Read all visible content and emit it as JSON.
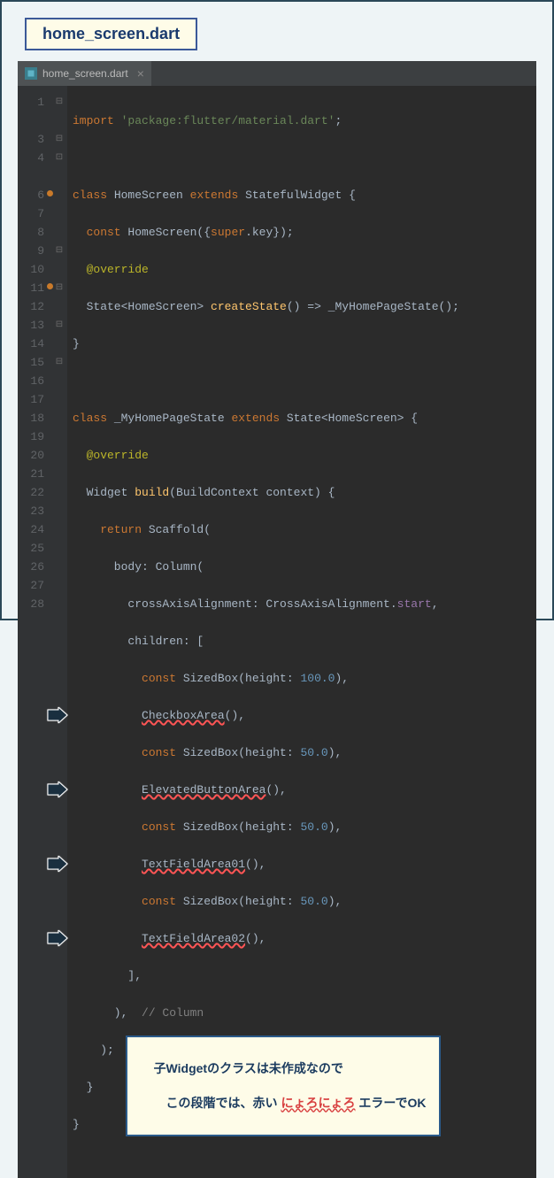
{
  "title_badge": "home_screen.dart",
  "tab": {
    "name": "home_screen.dart",
    "close": "×"
  },
  "gutter": {
    "lines": [
      "1",
      "",
      "3",
      "4",
      "",
      "6",
      "7",
      "8",
      "9",
      "10",
      "11",
      "12",
      "13",
      "14",
      "15",
      "16",
      "17",
      "18",
      "19",
      "20",
      "21",
      "22",
      "23",
      "24",
      "25",
      "26",
      "27",
      "28"
    ],
    "markers_at": [
      5,
      10
    ]
  },
  "fold_marks": {
    "0": "⊟",
    "2": "⊟",
    "3": "⊡",
    "8": "⊟",
    "10": "⊟",
    "12": "⊟",
    "14": "⊟"
  },
  "code": {
    "l1_import": "import ",
    "l1_str": "'package:flutter/material.dart'",
    "l1_end": ";",
    "l3_class": "class ",
    "l3_name": "HomeScreen ",
    "l3_extends": "extends ",
    "l3_parent": "StatefulWidget {",
    "l4_const": "  const ",
    "l4_ctor": "HomeScreen({",
    "l4_super": "super",
    "l4_key": ".key});",
    "l5_override": "  @override",
    "l6_pre": "  State<HomeScreen> ",
    "l6_fn": "createState",
    "l6_mid": "() => ",
    "l6_ret": "_MyHomePageState();",
    "l7": "}",
    "l9_class": "class ",
    "l9_name": "_MyHomePageState ",
    "l9_extends": "extends ",
    "l9_parent": "State<HomeScreen> {",
    "l10_override": "  @override",
    "l11_pre": "  Widget ",
    "l11_fn": "build",
    "l11_args": "(BuildContext context) {",
    "l12_ret": "    return ",
    "l12_scaf": "Scaffold(",
    "l13_body": "      body: ",
    "l13_col": "Column(",
    "l14_pre": "        crossAxisAlignment: CrossAxisAlignment.",
    "l14_start": "start",
    "l14_end": ",",
    "l15": "        children: [",
    "l16_const": "          const ",
    "l16_sb": "SizedBox",
    "l16_open": "(height: ",
    "l16_num": "100.0",
    "l16_close": "),",
    "l17_pre": "          ",
    "l17_err": "CheckboxArea",
    "l17_end": "(),",
    "l18_const": "          const ",
    "l18_sb": "SizedBox",
    "l18_num": "50.0",
    "l19_pre": "          ",
    "l19_err": "ElevatedButtonArea",
    "l19_end": "(),",
    "l20_const": "          const ",
    "l21_pre": "          ",
    "l21_err": "TextFieldArea01",
    "l21_end": "(),",
    "l22_const": "          const ",
    "l23_pre": "          ",
    "l23_err": "TextFieldArea02",
    "l23_end": "(),",
    "l24": "        ],",
    "l25_code": "      ),  ",
    "l25_com": "// Column",
    "l26_code": "    );  ",
    "l27": "  }",
    "l28": "}"
  },
  "annotation": {
    "line1": "子Widgetのクラスは未作成なので",
    "line2_a": "　この段階では、赤い ",
    "line2_red": "にょろにょろ",
    "line2_b": " エラーでOK"
  }
}
